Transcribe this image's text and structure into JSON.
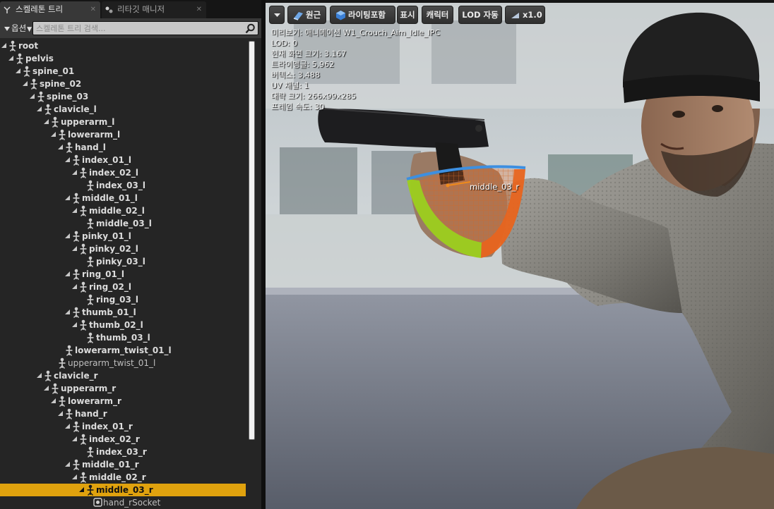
{
  "tabs": [
    {
      "label": "스켈레톤 트리",
      "active": true,
      "icon": "skeleton-tree-icon"
    },
    {
      "label": "리타깃 매니저",
      "active": false,
      "icon": "retarget-manager-icon"
    }
  ],
  "tree_toolbar": {
    "options_label": "옵션",
    "search_placeholder": "스켈레톤 트리 검색..."
  },
  "tree": {
    "selected": "middle_03_r",
    "rows": [
      {
        "label": "root",
        "depth": 0
      },
      {
        "label": "pelvis",
        "depth": 1
      },
      {
        "label": "spine_01",
        "depth": 2
      },
      {
        "label": "spine_02",
        "depth": 3
      },
      {
        "label": "spine_03",
        "depth": 4
      },
      {
        "label": "clavicle_l",
        "depth": 5
      },
      {
        "label": "upperarm_l",
        "depth": 6
      },
      {
        "label": "lowerarm_l",
        "depth": 7
      },
      {
        "label": "hand_l",
        "depth": 8
      },
      {
        "label": "index_01_l",
        "depth": 9
      },
      {
        "label": "index_02_l",
        "depth": 10
      },
      {
        "label": "index_03_l",
        "depth": 11,
        "leaf": true
      },
      {
        "label": "middle_01_l",
        "depth": 9
      },
      {
        "label": "middle_02_l",
        "depth": 10
      },
      {
        "label": "middle_03_l",
        "depth": 11,
        "leaf": true
      },
      {
        "label": "pinky_01_l",
        "depth": 9
      },
      {
        "label": "pinky_02_l",
        "depth": 10
      },
      {
        "label": "pinky_03_l",
        "depth": 11,
        "leaf": true
      },
      {
        "label": "ring_01_l",
        "depth": 9
      },
      {
        "label": "ring_02_l",
        "depth": 10
      },
      {
        "label": "ring_03_l",
        "depth": 11,
        "leaf": true
      },
      {
        "label": "thumb_01_l",
        "depth": 9
      },
      {
        "label": "thumb_02_l",
        "depth": 10
      },
      {
        "label": "thumb_03_l",
        "depth": 11,
        "leaf": true
      },
      {
        "label": "lowerarm_twist_01_l",
        "depth": 8,
        "leaf": true
      },
      {
        "label": "upperarm_twist_01_l",
        "depth": 7,
        "leaf": true,
        "weak": true
      },
      {
        "label": "clavicle_r",
        "depth": 5
      },
      {
        "label": "upperarm_r",
        "depth": 6
      },
      {
        "label": "lowerarm_r",
        "depth": 7
      },
      {
        "label": "hand_r",
        "depth": 8
      },
      {
        "label": "index_01_r",
        "depth": 9
      },
      {
        "label": "index_02_r",
        "depth": 10
      },
      {
        "label": "index_03_r",
        "depth": 11,
        "leaf": true
      },
      {
        "label": "middle_01_r",
        "depth": 9
      },
      {
        "label": "middle_02_r",
        "depth": 10
      },
      {
        "label": "middle_03_r",
        "depth": 11
      },
      {
        "label": "hand_rSocket",
        "depth": 12,
        "leaf": true,
        "weak": true,
        "socket": true
      }
    ]
  },
  "viewport": {
    "toolbar": [
      {
        "key": "menu",
        "label": "",
        "icon": "chevron-down-icon"
      },
      {
        "key": "perspective",
        "label": "원근",
        "icon": "perspective-icon"
      },
      {
        "key": "lighting",
        "label": "라이팅포함",
        "icon": "lit-cube-icon"
      },
      {
        "key": "show",
        "label": "표시",
        "icon": ""
      },
      {
        "key": "character",
        "label": "캐릭터",
        "icon": ""
      },
      {
        "key": "lod",
        "label": "LOD 자동",
        "icon": ""
      },
      {
        "key": "speed",
        "label": "x1.0",
        "icon": "playback-speed-icon"
      }
    ],
    "stats": [
      "미리보기: 애니메이션 W1_Crouch_Aim_Idle_IPC",
      "LOD: 0",
      "현재 화면 크기: 3.167",
      "트라이앵글: 5,962",
      "버텍스: 3,488",
      "UV 채널: 1",
      "대략 크기: 266x99x285",
      "프레임 속도: 30"
    ],
    "selected_bone_label": "middle_03_r"
  },
  "colors": {
    "selection": "#e0a20e",
    "panel_bg": "#252525",
    "rotation_gizmo_x": "#e8641e",
    "rotation_gizmo_y": "#9ccf1e",
    "rotation_gizmo_z": "#3d8fe0"
  }
}
